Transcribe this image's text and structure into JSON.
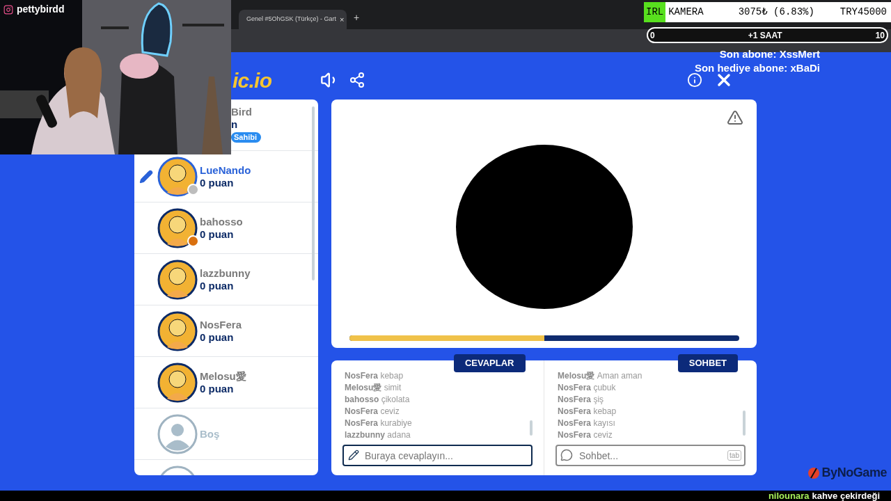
{
  "browser": {
    "tab_title": "Genel #5OhGSK (Türkçe) - Gart",
    "tab_close": "×",
    "new_tab": "+"
  },
  "stream_overlay": {
    "handle": "pettybirdd",
    "goal": {
      "tag": "IRL",
      "label": "KAMERA",
      "amount": "3075₺ (6.83%)",
      "target": "TRY45000"
    },
    "timer": {
      "start": "0",
      "label": "+1 SAAT",
      "end": "10"
    },
    "subscriber": "Son abone: XssMert",
    "gift": "Son hediye abone: xBaDi",
    "sponsor": "ByNoGame",
    "ticker": {
      "user": "nilounara",
      "item": "kahve çekirdeği"
    }
  },
  "game": {
    "logo": "ic.io",
    "players": [
      {
        "kind": "owner",
        "name": "Bird",
        "score": "n",
        "badge": "Sahibi"
      },
      {
        "kind": "player",
        "name": "LueNando",
        "score": "0 puan",
        "drawing": true,
        "color": "#bdbdbd"
      },
      {
        "kind": "player",
        "name": "bahosso",
        "score": "0 puan",
        "drawing": false,
        "color": "#d9700f"
      },
      {
        "kind": "player",
        "name": "lazzbunny",
        "score": "0 puan",
        "drawing": false
      },
      {
        "kind": "player",
        "name": "NosFera",
        "score": "0 puan",
        "drawing": false
      },
      {
        "kind": "player",
        "name": "Melosu愛",
        "score": "0 puan",
        "drawing": false
      },
      {
        "kind": "empty",
        "name": "Boş"
      },
      {
        "kind": "cut"
      }
    ],
    "timer": {
      "level": 0.5
    },
    "answers": {
      "title": "CEVAPLAR",
      "placeholder": "Buraya cevaplayın...",
      "messages": [
        {
          "user": "NosFera",
          "text": "kebap"
        },
        {
          "user": "Melosu愛",
          "text": "simit"
        },
        {
          "user": "bahosso",
          "text": "çikolata"
        },
        {
          "user": "NosFera",
          "text": "ceviz"
        },
        {
          "user": "NosFera",
          "text": "kurabiye"
        },
        {
          "user": "lazzbunny",
          "text": "adana"
        }
      ]
    },
    "chat": {
      "title": "SOHBET",
      "placeholder": "Sohbet...",
      "key_hint": "tab",
      "messages": [
        {
          "user": "Melosu愛",
          "text": "Aman aman"
        },
        {
          "user": "NosFera",
          "text": "çubuk"
        },
        {
          "user": "NosFera",
          "text": "şiş"
        },
        {
          "user": "NosFera",
          "text": "kebap"
        },
        {
          "user": "NosFera",
          "text": "kayısı"
        },
        {
          "user": "NosFera",
          "text": "ceviz"
        }
      ]
    }
  }
}
